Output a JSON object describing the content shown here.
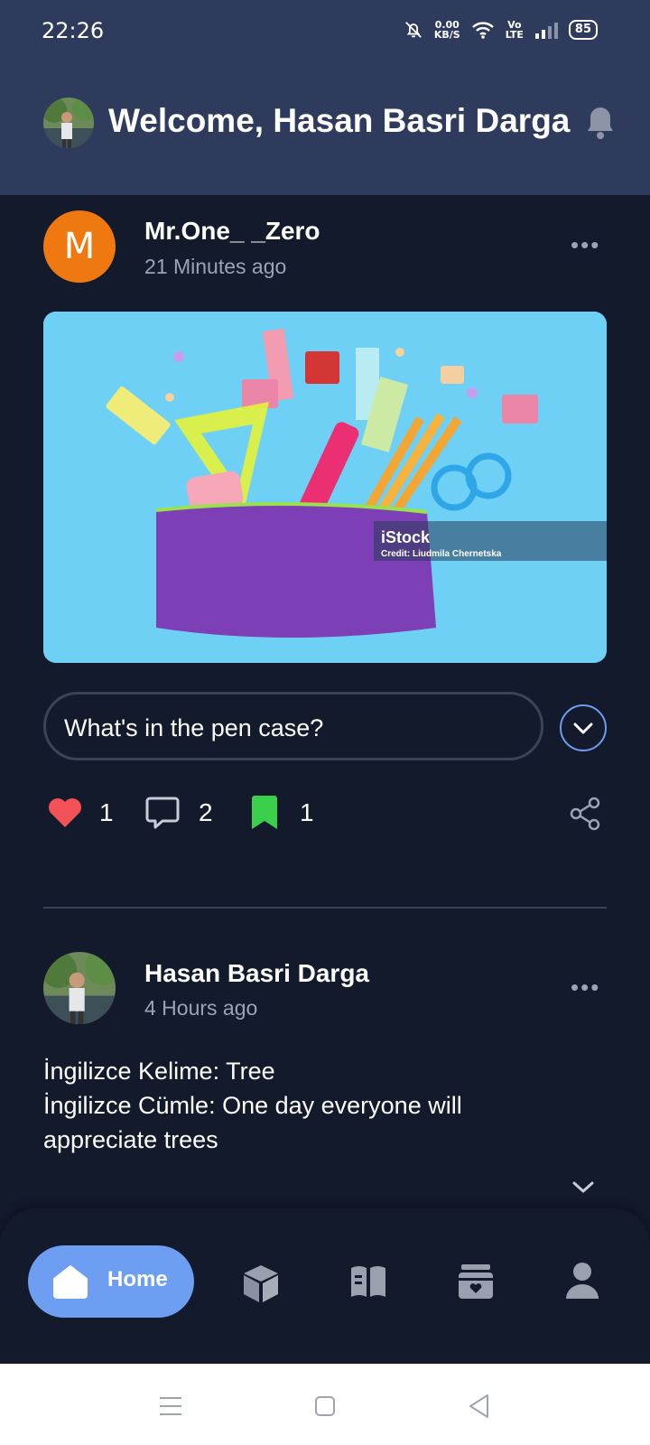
{
  "status_bar": {
    "time": "22:26",
    "net_speed_value": "0.00",
    "net_speed_unit": "KB/S",
    "volte_top": "Vo",
    "volte_bottom": "LTE",
    "battery": "85"
  },
  "header": {
    "welcome": "Welcome, Hasan Basri Darga"
  },
  "posts": [
    {
      "author": "Mr.One_ _Zero",
      "avatar_letter": "M",
      "time": "21 Minutes ago",
      "more": "•••",
      "image_watermark": "iStock",
      "image_credit": "Credit: Liudmila Chernetska",
      "question": "What's in the pen case?",
      "likes": "1",
      "comments": "2",
      "saves": "1"
    },
    {
      "author": "Hasan Basri Darga",
      "time": "4 Hours ago",
      "more": "•••",
      "text_lines": [
        "İngilizce Kelime: Tree",
        "İngilizce Cümle: One day everyone will",
        "appreciate trees"
      ]
    }
  ],
  "bottom_nav": {
    "home_label": "Home",
    "icons": [
      "home-icon",
      "cube-icon",
      "book-icon",
      "archive-icon",
      "profile-icon"
    ]
  },
  "colors": {
    "header_bg": "#2f3b5c",
    "page_bg": "#131a2b",
    "accent": "#6e9ef1",
    "like": "#f25157",
    "save": "#3ad04b",
    "avatar_orange": "#f07811"
  }
}
